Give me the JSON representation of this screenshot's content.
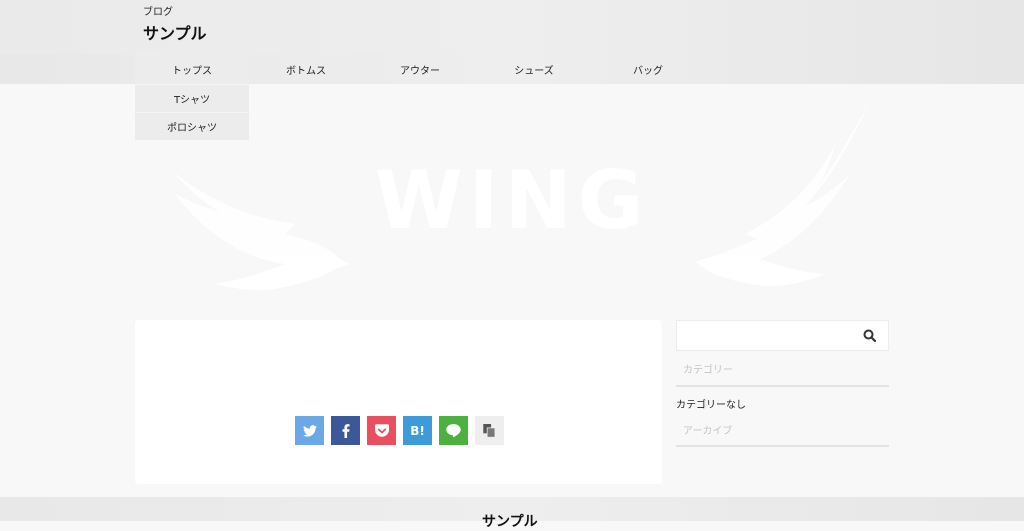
{
  "header": {
    "subtitle": "ブログ",
    "title": "サンプル"
  },
  "nav": {
    "items": [
      {
        "label": "トップス"
      },
      {
        "label": "ボトムス"
      },
      {
        "label": "アウター"
      },
      {
        "label": "シューズ"
      },
      {
        "label": "バッグ"
      }
    ],
    "dropdown": [
      {
        "label": "Tシャツ"
      },
      {
        "label": "ポロシャツ"
      }
    ]
  },
  "hero": {
    "logo_text": "WING"
  },
  "share": {
    "buttons": [
      {
        "name": "twitter",
        "color": "#6aa8e6"
      },
      {
        "name": "facebook",
        "color": "#3b5998"
      },
      {
        "name": "pocket",
        "color": "#e94f5e"
      },
      {
        "name": "hatena",
        "label": "B!",
        "color": "#3c9bd8"
      },
      {
        "name": "line",
        "color": "#4cb13e"
      },
      {
        "name": "copy",
        "color": "#eeeeee"
      }
    ]
  },
  "sidebar": {
    "search_placeholder": "",
    "category_title": "カテゴリー",
    "category_item": "カテゴリーなし",
    "archive_title": "アーカイブ"
  },
  "footer": {
    "title": "サンプル"
  },
  "colors": {
    "background": "#f8f8f8",
    "card": "#ffffff",
    "nav": "#eeeeee"
  }
}
